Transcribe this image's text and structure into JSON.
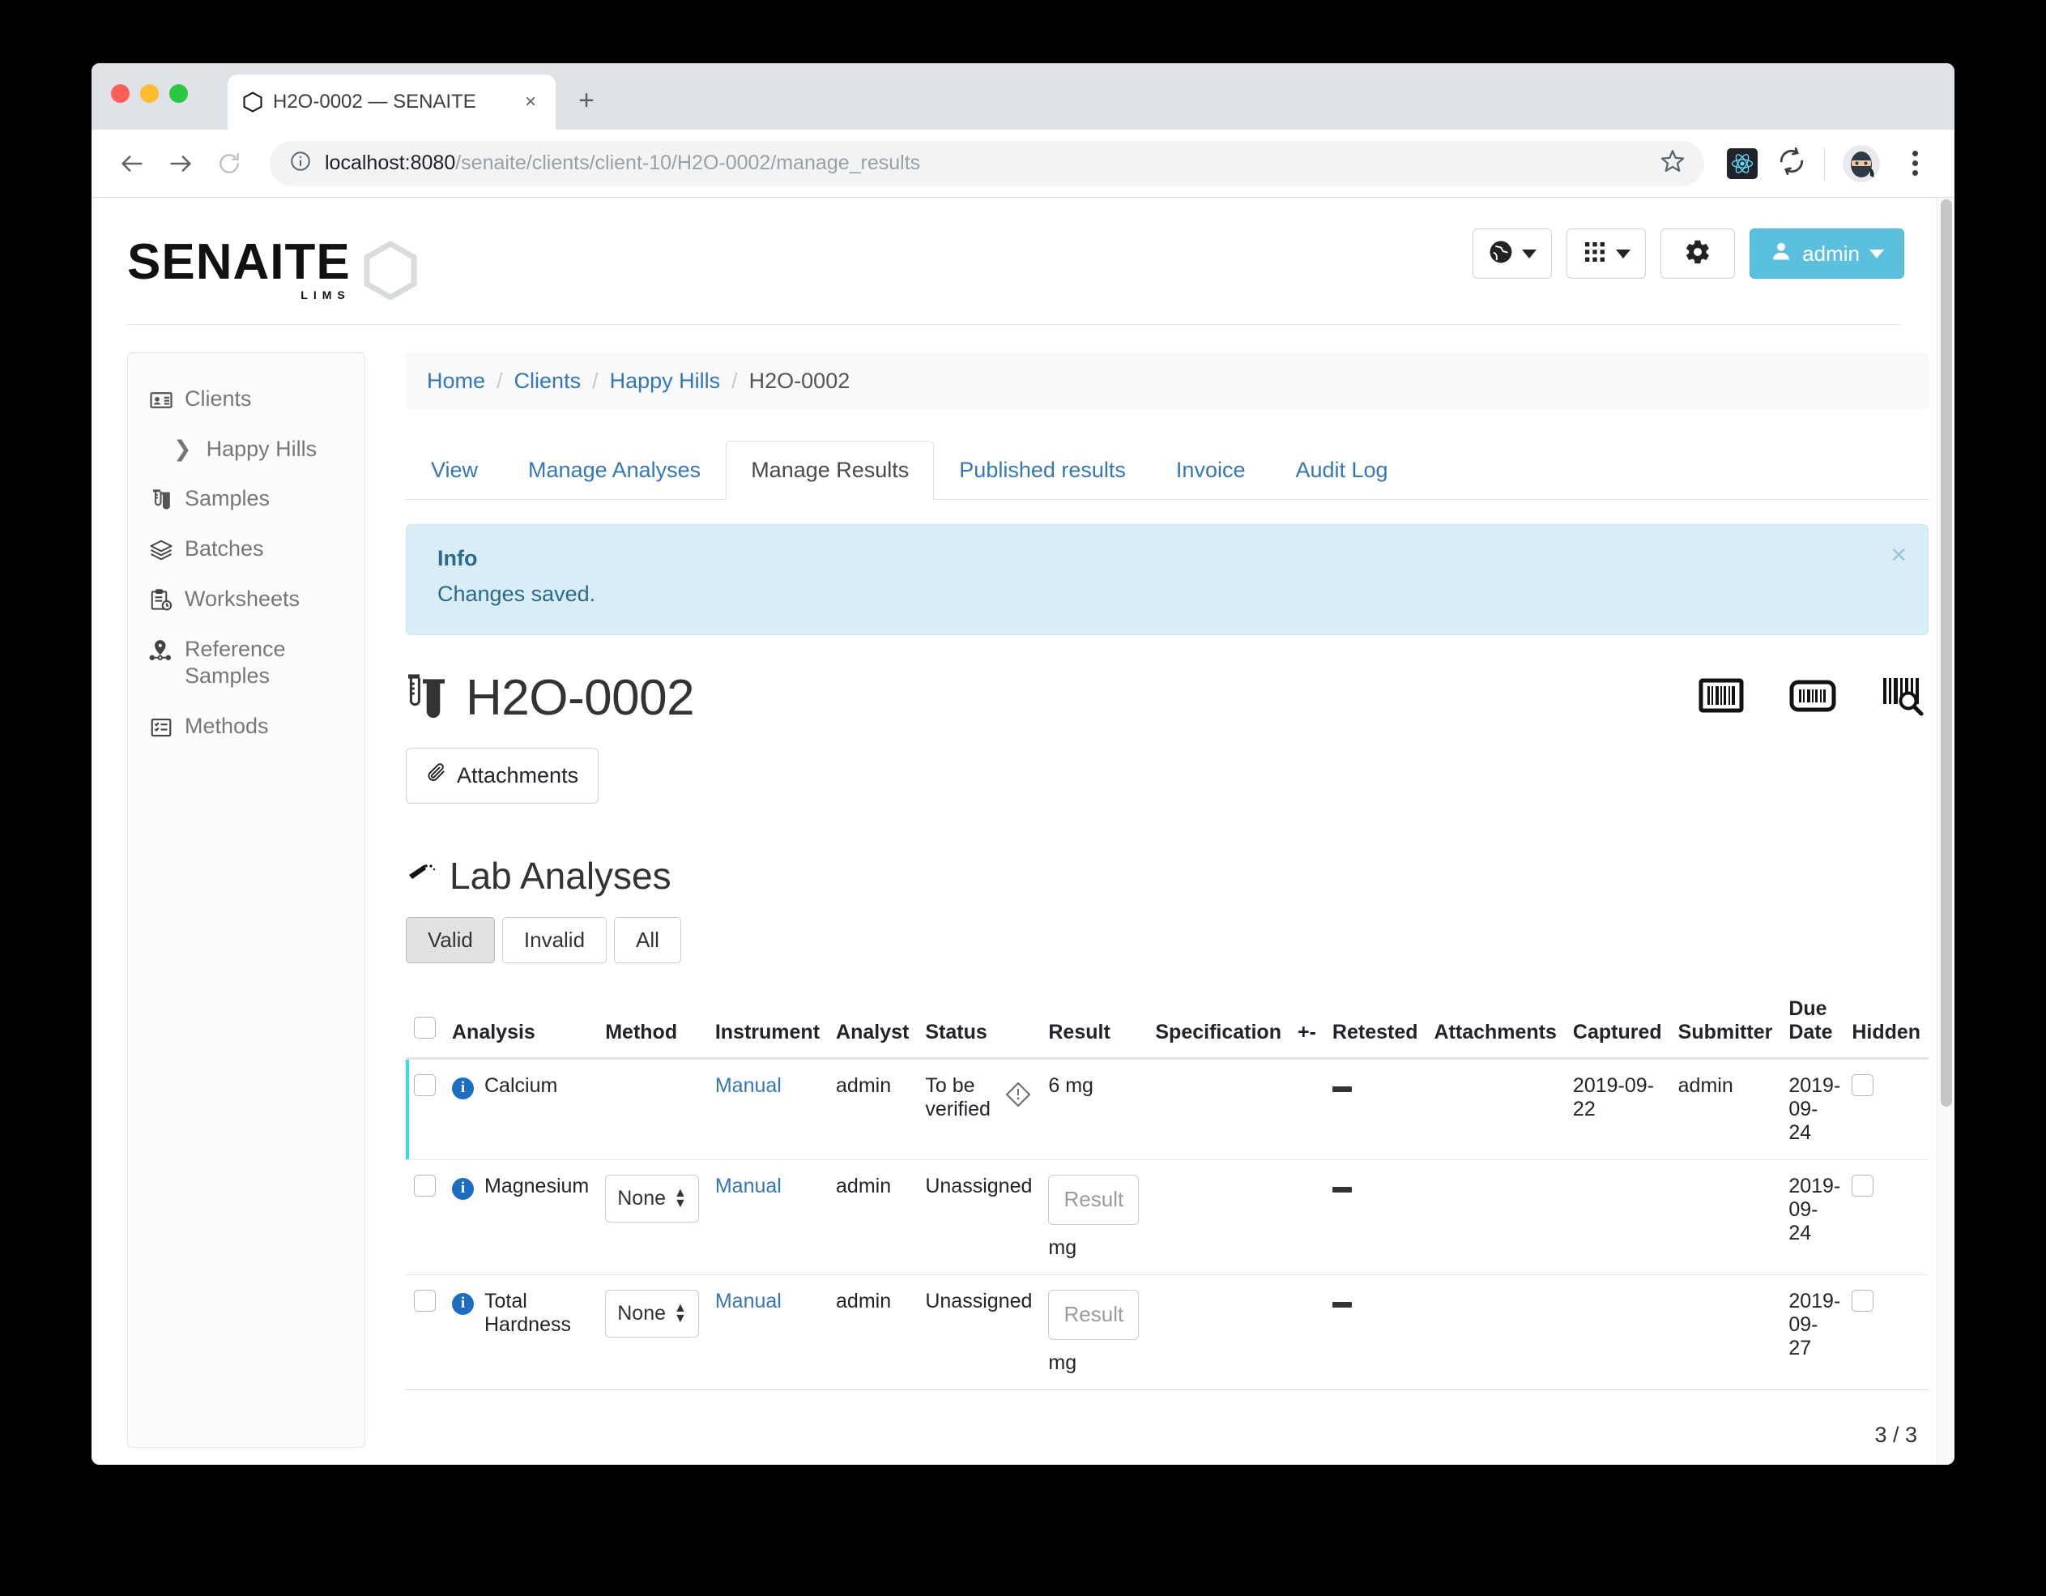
{
  "browser": {
    "tab_title": "H2O-0002 — SENAITE",
    "tab_close_glyph": "×",
    "new_tab_glyph": "+",
    "url_host": "localhost:8080",
    "url_path": "/senaite/clients/client-10/H2O-0002/manage_results",
    "back_glyph": "←",
    "forward_glyph": "→",
    "reload_glyph": "⟳"
  },
  "header": {
    "logo_word": "SENAITE",
    "logo_sub": "LIMS",
    "user_label": "admin"
  },
  "sidebar": {
    "items": [
      {
        "label": "Clients",
        "icon": "id-card-icon",
        "sub": false
      },
      {
        "label": "Happy Hills",
        "icon": "chevron-right-icon",
        "sub": true
      },
      {
        "label": "Samples",
        "icon": "test-tube-icon",
        "sub": false
      },
      {
        "label": "Batches",
        "icon": "layers-icon",
        "sub": false
      },
      {
        "label": "Worksheets",
        "icon": "clipboard-clock-icon",
        "sub": false
      },
      {
        "label": "Reference Samples",
        "icon": "map-pin-nodes-icon",
        "sub": false
      },
      {
        "label": "Methods",
        "icon": "checklist-icon",
        "sub": false
      }
    ]
  },
  "breadcrumb": {
    "items": [
      "Home",
      "Clients",
      "Happy Hills"
    ],
    "current": "H2O-0002",
    "separator": "/"
  },
  "tabs": [
    {
      "label": "View",
      "active": false
    },
    {
      "label": "Manage Analyses",
      "active": false
    },
    {
      "label": "Manage Results",
      "active": true
    },
    {
      "label": "Published results",
      "active": false
    },
    {
      "label": "Invoice",
      "active": false
    },
    {
      "label": "Audit Log",
      "active": false
    }
  ],
  "alert": {
    "title": "Info",
    "message": "Changes saved.",
    "close_glyph": "×"
  },
  "sample": {
    "title": "H2O-0002",
    "attachments_label": "Attachments",
    "barcode_icons": [
      "barcode-box-icon",
      "barcode-rounded-icon",
      "barcode-search-icon"
    ]
  },
  "analyses": {
    "section_title": "Lab Analyses",
    "filters": [
      {
        "label": "Valid",
        "active": true
      },
      {
        "label": "Invalid",
        "active": false
      },
      {
        "label": "All",
        "active": false
      }
    ],
    "columns": [
      "Analysis",
      "Method",
      "Instrument",
      "Analyst",
      "Status",
      "Result",
      "Specification",
      "+-",
      "Retested",
      "Attachments",
      "Captured",
      "Submitter",
      "Due Date",
      "Hidden"
    ],
    "rows": [
      {
        "analysis": "Calcium",
        "method": "",
        "method_is_select": false,
        "instrument": "Manual",
        "analyst": "admin",
        "status": "To be verified",
        "status_warning": true,
        "result_value": "6 mg",
        "result_is_input": false,
        "result_unit": "",
        "specification": "",
        "plusminus": "",
        "retested": "—",
        "attachments": "",
        "captured": "2019-09-22",
        "submitter": "admin",
        "due_date": "2019-09-24",
        "hidden_checked": false
      },
      {
        "analysis": "Magnesium",
        "method": "None",
        "method_is_select": true,
        "instrument": "Manual",
        "analyst": "admin",
        "status": "Unassigned",
        "status_warning": false,
        "result_value": "Result",
        "result_is_input": true,
        "result_unit": "mg",
        "specification": "",
        "plusminus": "",
        "retested": "—",
        "attachments": "",
        "captured": "",
        "submitter": "",
        "due_date": "2019-09-24",
        "hidden_checked": false
      },
      {
        "analysis": "Total Hardness",
        "method": "None",
        "method_is_select": true,
        "instrument": "Manual",
        "analyst": "admin",
        "status": "Unassigned",
        "status_warning": false,
        "result_value": "Result",
        "result_is_input": true,
        "result_unit": "mg",
        "specification": "",
        "plusminus": "",
        "retested": "—",
        "attachments": "",
        "captured": "",
        "submitter": "",
        "due_date": "2019-09-27",
        "hidden_checked": false
      }
    ],
    "pager": "3 / 3"
  },
  "colors": {
    "accent": "#5bc0de",
    "link": "#3477b5",
    "info_bg": "#d9edf7",
    "row_marker": "#2fe0ef"
  }
}
